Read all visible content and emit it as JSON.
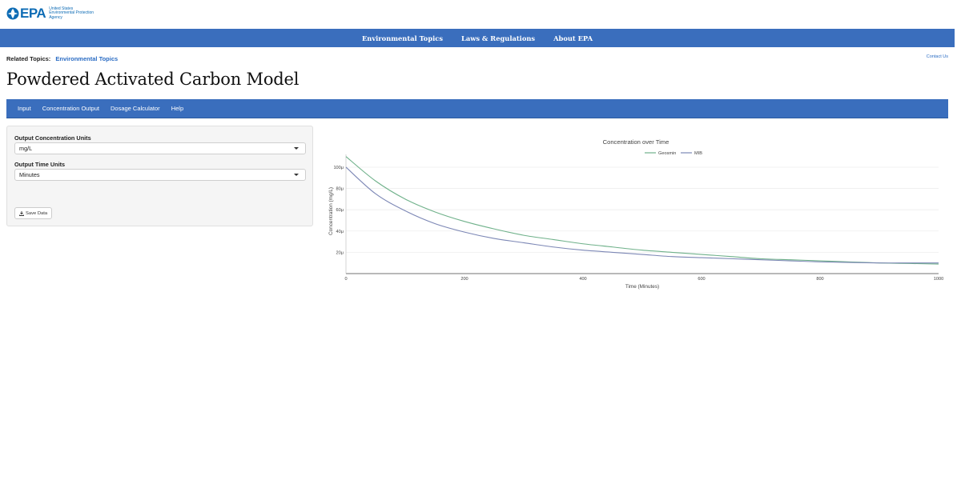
{
  "header": {
    "logo_word": "EPA",
    "logo_sub": "United States\nEnvironmental Protection\nAgency"
  },
  "top_nav": [
    {
      "label": "Environmental Topics"
    },
    {
      "label": "Laws & Regulations"
    },
    {
      "label": "About EPA"
    }
  ],
  "related": {
    "label": "Related Topics:",
    "link": "Environmental Topics"
  },
  "contact": "Contact Us",
  "page_title": "Powdered Activated Carbon Model",
  "tabs": [
    {
      "label": "Input"
    },
    {
      "label": "Concentration Output"
    },
    {
      "label": "Dosage Calculator"
    },
    {
      "label": "Help"
    }
  ],
  "panel": {
    "conc_label": "Output Concentration Units",
    "conc_value": "mg/L",
    "time_label": "Output Time Units",
    "time_value": "Minutes",
    "save_label": "Save Data"
  },
  "colors": {
    "nav": "#3a6ebd",
    "brand": "#0e6cb5",
    "geosmin": "#6fb18a",
    "mib": "#7c87b5"
  },
  "chart_data": {
    "type": "line",
    "title": "Concentration over Time",
    "xlabel": "Time (Minutes)",
    "ylabel": "Concentration (mg/L)",
    "xlim": [
      0,
      1000
    ],
    "ylim": [
      0,
      112
    ],
    "xticks": [
      "0",
      "200",
      "400",
      "600",
      "800",
      "1000"
    ],
    "yticks": [
      "20μ",
      "40μ",
      "60μ",
      "80μ",
      "100μ"
    ],
    "ytick_values": [
      20,
      40,
      60,
      80,
      100
    ],
    "xtick_values": [
      0,
      200,
      400,
      600,
      800,
      1000
    ],
    "grid": true,
    "legend": "top-right",
    "x": [
      0,
      50,
      100,
      150,
      200,
      250,
      300,
      350,
      400,
      450,
      500,
      550,
      600,
      650,
      700,
      750,
      800,
      850,
      900,
      950,
      1000
    ],
    "series": [
      {
        "name": "Geosmin",
        "color": "#6fb18a",
        "values": [
          110,
          87,
          70,
          58,
          49,
          42,
          36,
          32,
          28,
          25,
          22,
          20,
          18,
          16,
          14,
          13,
          12,
          11,
          10,
          9.5,
          9
        ]
      },
      {
        "name": "MIB",
        "color": "#7c87b5",
        "values": [
          100,
          75,
          59,
          47,
          39,
          33,
          29,
          25,
          22,
          20,
          18,
          16,
          15,
          14,
          13,
          12,
          11,
          10.5,
          10,
          10,
          10
        ]
      }
    ]
  }
}
